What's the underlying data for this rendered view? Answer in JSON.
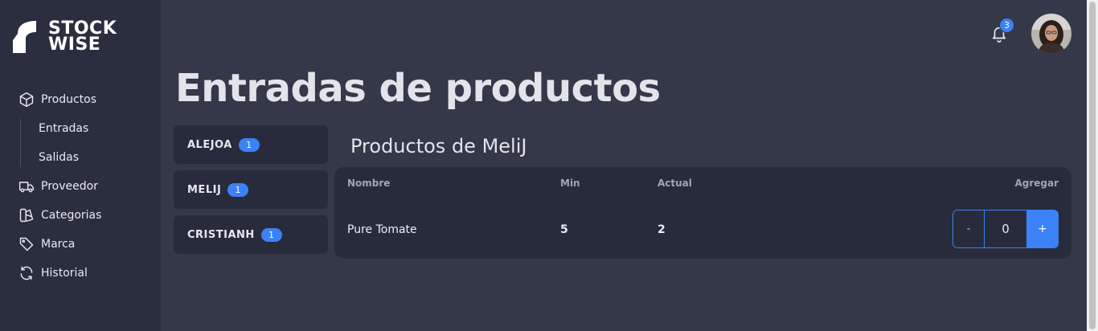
{
  "brand": {
    "line1": "STOCK",
    "line2": "WISE"
  },
  "sidebar": {
    "items": [
      {
        "label": "Productos",
        "icon": "box-icon"
      },
      {
        "label": "Entradas"
      },
      {
        "label": "Salidas"
      },
      {
        "label": "Proveedor",
        "icon": "truck-icon"
      },
      {
        "label": "Categorias",
        "icon": "category-icon"
      },
      {
        "label": "Marca",
        "icon": "tag-icon"
      },
      {
        "label": "Historial",
        "icon": "history-icon"
      }
    ]
  },
  "header": {
    "notifications_count": "3",
    "accent_color": "#3b82f6"
  },
  "page": {
    "title": "Entradas de productos"
  },
  "users": [
    {
      "name": "ALEJOA",
      "count": "1"
    },
    {
      "name": "MELIJ",
      "count": "1"
    },
    {
      "name": "CRISTIANH",
      "count": "1"
    }
  ],
  "products": {
    "title": "Productos de MeliJ",
    "columns": {
      "name": "Nombre",
      "min": "Min",
      "actual": "Actual",
      "add": "Agregar"
    },
    "rows": [
      {
        "name": "Pure Tomate",
        "min": "5",
        "actual": "2",
        "qty": "0"
      }
    ],
    "minus_label": "-",
    "plus_label": "+"
  }
}
